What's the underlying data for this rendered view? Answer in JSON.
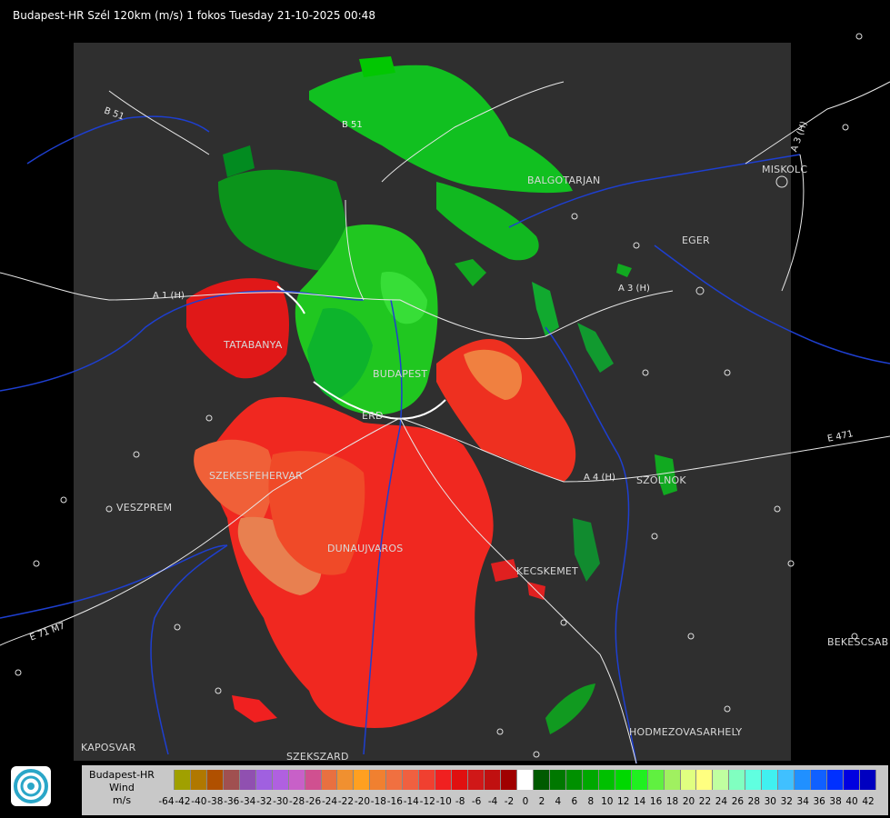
{
  "header": {
    "title": "Budapest-HR Szél 120km (m/s) 1 fokos Tuesday 21-10-2025 00:48"
  },
  "cities": [
    {
      "key": "balgotarjan",
      "label": "BALGOTARJAN"
    },
    {
      "key": "miskolc",
      "label": "MISKOLC"
    },
    {
      "key": "eger",
      "label": "EGER"
    },
    {
      "key": "tatabanya",
      "label": "TATABANYA"
    },
    {
      "key": "budapest",
      "label": "BUDAPEST"
    },
    {
      "key": "erd",
      "label": "ERD"
    },
    {
      "key": "szekesfehervar",
      "label": "SZEKESFEHERVAR"
    },
    {
      "key": "veszprem",
      "label": "VESZPREM"
    },
    {
      "key": "dunaujvaros",
      "label": "DUNAUJVAROS"
    },
    {
      "key": "kecskemet",
      "label": "KECSKEMET"
    },
    {
      "key": "szolnok",
      "label": "SZOLNOK"
    },
    {
      "key": "bekescsaba",
      "label": "BEKESCSAB"
    },
    {
      "key": "hodmezovasarhely",
      "label": "HODMEZOVASARHELY"
    },
    {
      "key": "kaposvar",
      "label": "KAPOSVAR"
    },
    {
      "key": "szekszard",
      "label": "SZEKSZARD"
    }
  ],
  "roads": [
    {
      "key": "b51",
      "label": "B 51"
    },
    {
      "key": "b51b",
      "label": "B 51"
    },
    {
      "key": "a3h",
      "label": "A 3 (H)"
    },
    {
      "key": "a3h-ne",
      "label": "A 3 (H)"
    },
    {
      "key": "a1h",
      "label": "A 1 (H)"
    },
    {
      "key": "a4h",
      "label": "A 4 (H)"
    },
    {
      "key": "e471",
      "label": "E 471"
    },
    {
      "key": "e71",
      "label": "E 71 M7"
    }
  ],
  "legend": {
    "title_line1": "Budapest-HR",
    "title_line2": "Wind",
    "title_line3": "m/s",
    "ticks": [
      "-64",
      "-42",
      "-40",
      "-38",
      "-36",
      "-34",
      "-32",
      "-30",
      "-28",
      "-26",
      "-24",
      "-22",
      "-20",
      "-18",
      "-16",
      "-14",
      "-12",
      "-10",
      "-8",
      "-6",
      "-4",
      "-2",
      "0",
      "2",
      "4",
      "6",
      "8",
      "10",
      "12",
      "14",
      "16",
      "18",
      "20",
      "22",
      "24",
      "26",
      "28",
      "30",
      "32",
      "34",
      "36",
      "38",
      "40",
      "42"
    ],
    "colors": [
      "#c8c8c8",
      "#a0a000",
      "#b07800",
      "#b05000",
      "#a05050",
      "#9050b0",
      "#a060e0",
      "#b060e0",
      "#c860c8",
      "#d05090",
      "#e87040",
      "#f09030",
      "#ffa020",
      "#f08030",
      "#f07040",
      "#f06040",
      "#f04030",
      "#f02020",
      "#e01010",
      "#d01818",
      "#c01010",
      "#a00000",
      "#ffffff",
      "#005a00",
      "#007800",
      "#009000",
      "#00a800",
      "#00c000",
      "#00d800",
      "#20f020",
      "#60f040",
      "#a0f060",
      "#e0ff80",
      "#ffff80",
      "#c0ffa0",
      "#80ffc0",
      "#60ffe0",
      "#40f0f0",
      "#40c0ff",
      "#2090ff",
      "#1060ff",
      "#0030ff",
      "#0000e0",
      "#0000c0"
    ]
  }
}
